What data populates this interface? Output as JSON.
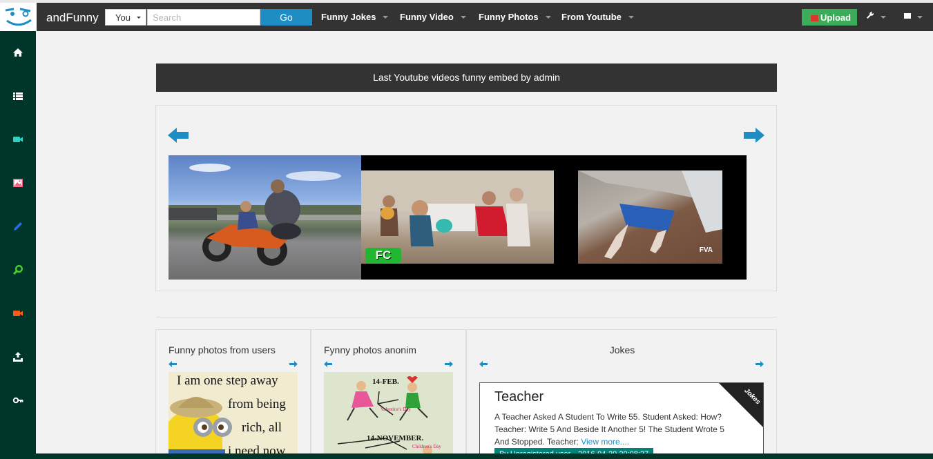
{
  "header": {
    "brand": "andFunny",
    "scope_select": "You",
    "search_placeholder": "Search",
    "go_label": "Go",
    "menus": [
      {
        "label": "Funny Jokes"
      },
      {
        "label": "Funny Video"
      },
      {
        "label": "Funny Photos"
      },
      {
        "label": "From Youtube"
      }
    ],
    "upload_label": "Upload",
    "upload_icon": "upload-icon",
    "tools_icon": "wrench-icon",
    "messages_icon": "envelope-icon",
    "colors": {
      "navbar": "#333333",
      "go": "#1d8dc4",
      "upload": "#3cab5a",
      "sidebar": "#00362a"
    }
  },
  "sidebar": {
    "items": [
      {
        "name": "home",
        "icon": "home-icon",
        "color": "#ffffff"
      },
      {
        "name": "list",
        "icon": "list-icon",
        "color": "#ffffff"
      },
      {
        "name": "video",
        "icon": "video-camera-icon",
        "color": "#2ed3c4"
      },
      {
        "name": "photo",
        "icon": "picture-icon",
        "color": "#f05a7e"
      },
      {
        "name": "edit",
        "icon": "pencil-icon",
        "color": "#1e6ef5"
      },
      {
        "name": "search",
        "icon": "search-icon",
        "color": "#47d22a"
      },
      {
        "name": "youtube",
        "icon": "video-camera-icon",
        "color": "#ff5a1e"
      },
      {
        "name": "upload",
        "icon": "upload-tray-icon",
        "color": "#ffffff"
      },
      {
        "name": "login",
        "icon": "key-icon",
        "color": "#ffffff"
      }
    ]
  },
  "youtube_section": {
    "title": "Last Youtube videos funny embed by admin",
    "prev_icon": "arrow-left-icon",
    "next_icon": "arrow-right-icon",
    "videos": [
      {
        "name": "video-thumb-motorcycle"
      },
      {
        "name": "video-thumb-balloon-party",
        "badge": "FC"
      },
      {
        "name": "video-thumb-stuck-under",
        "badge": "FVA"
      }
    ]
  },
  "bottom": {
    "users_photos": {
      "title": "Funny photos from users",
      "image_text": [
        "I am one step away",
        "from being",
        "rich, all",
        "i need now"
      ]
    },
    "anon_photos": {
      "title": "Fynny photos anonim",
      "image_text": [
        "14-FEB.",
        "Valentine's Day",
        "14-NOVEMBER.",
        "Children's Day"
      ]
    },
    "jokes": {
      "title": "Jokes",
      "card": {
        "ribbon": "Jokes",
        "title": "Teacher",
        "text": "A Teacher Asked A Student To Write 55. Student Asked: How? Teacher: Write 5 And Beside It Another 5! The Student Wrote 5 And Stopped. Teacher:",
        "more": "View more....",
        "author": "By Unregistered user",
        "date": "2016-04-20 20:08:27"
      }
    }
  }
}
